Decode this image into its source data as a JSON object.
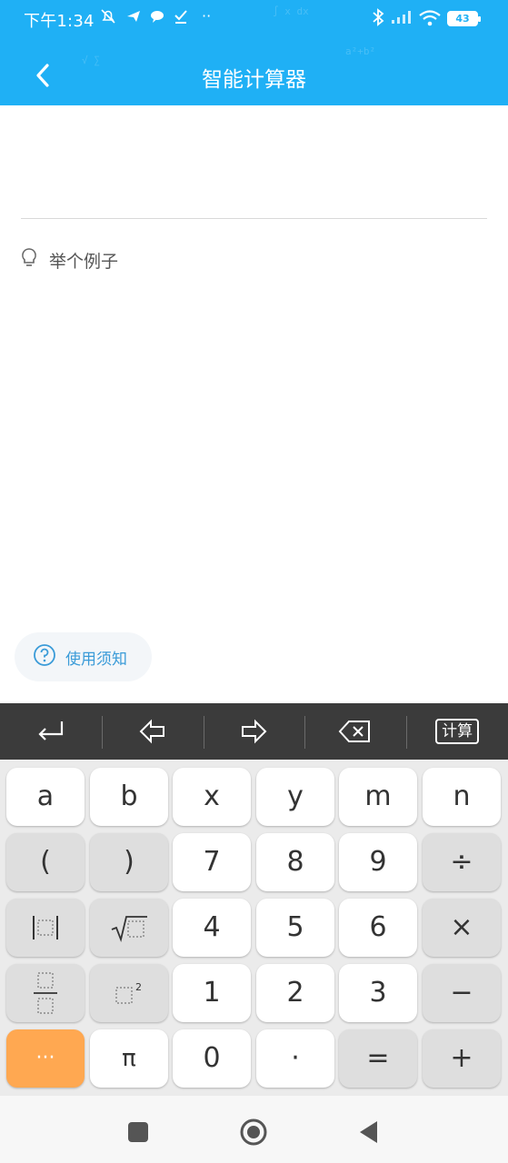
{
  "status_bar": {
    "time": "下午1:34",
    "battery": "43"
  },
  "header": {
    "title": "智能计算器"
  },
  "input": {
    "value": ""
  },
  "example": {
    "label": "举个例子"
  },
  "help": {
    "label": "使用须知"
  },
  "toolbar": {
    "calculate_label": "计算",
    "icons": [
      "enter-icon",
      "cursor-left-icon",
      "cursor-right-icon",
      "backspace-icon"
    ]
  },
  "keypad": {
    "rows": [
      [
        "a",
        "b",
        "x",
        "y",
        "m",
        "n"
      ],
      [
        "(",
        ")",
        "7",
        "8",
        "9",
        "÷"
      ],
      [
        "abs",
        "sqrt",
        "4",
        "5",
        "6",
        "×"
      ],
      [
        "fraction",
        "square",
        "1",
        "2",
        "3",
        "−"
      ],
      [
        "···",
        "π",
        "0",
        "·",
        "=",
        "+"
      ]
    ]
  },
  "colors": {
    "brand": "#1fb0f5",
    "accent_orange": "#ffa851",
    "help_text": "#3a9bd8",
    "toolbar_bg": "#3b3b3b"
  }
}
